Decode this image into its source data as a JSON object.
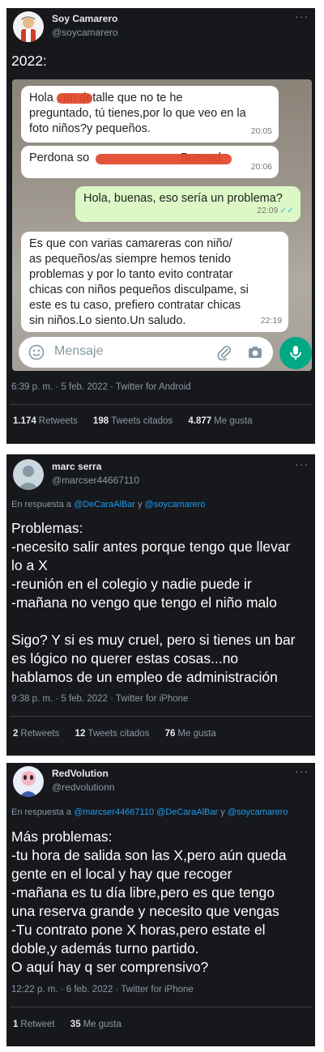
{
  "tweet1": {
    "name": "Soy Camarero",
    "handle": "@soycamarero",
    "more": "···",
    "text": "2022:",
    "chat": {
      "messages": [
        {
          "text": "Hola       , un detalle que no te he\npreguntado, tú tienes,por lo que veo en la\nfoto niños?y pequeños.",
          "time": "20:05"
        },
        {
          "text": "Perdona so                            Buenad",
          "time": "20:06"
        },
        {
          "text": "Hola, buenas, eso sería un problema?",
          "time": "22:09"
        },
        {
          "text": "Es que con varias camareras con niño/\nas pequeños/as siempre hemos tenido\nproblemas y por lo tanto evito contratar\nchicas con niños pequeños disculpame, si\neste es tu caso, prefiero contratar chicas\nsin niños.Lo siento.Un saludo.",
          "time": "22:19"
        }
      ],
      "input_placeholder": "Mensaje",
      "icons": [
        "emoji-icon",
        "attach-icon",
        "camera-icon",
        "mic-icon"
      ]
    },
    "meta": "6:39 p. m. · 5 feb. 2022 · Twitter for Android",
    "stats": [
      {
        "count": "1.174",
        "label": "Retweets"
      },
      {
        "count": "198",
        "label": "Tweets citados"
      },
      {
        "count": "4.877",
        "label": "Me gusta"
      }
    ]
  },
  "tweet2": {
    "name": "marc serra",
    "handle": "@marcser44667110",
    "more": "···",
    "reply_prefix": "En respuesta a",
    "mention1": "@DeCaraAlBar",
    "reply_and": "y",
    "mention2": "@soycamarero",
    "text": "Problemas:\n-necesito salir antes porque tengo que llevar\nlo a X\n-reunión en el colegio y nadie puede ir\n-mañana no vengo que tengo el niño malo\n\nSigo? Y si es muy cruel, pero si tienes un bar\nes lógico no querer estas cosas...no\nhablamos de un empleo de administración",
    "meta": "9:38 p. m. · 5 feb. 2022 · Twitter for iPhone",
    "stats": [
      {
        "count": "2",
        "label": "Retweets"
      },
      {
        "count": "12",
        "label": "Tweets citados"
      },
      {
        "count": "76",
        "label": "Me gusta"
      }
    ]
  },
  "tweet3": {
    "name": "RedVolution",
    "handle": "@redvolutionn",
    "more": "···",
    "reply_prefix": "En respuesta a",
    "mention1": "@marcser44667110",
    "mention2": "@DeCaraAlBar",
    "reply_and": "y",
    "mention3": "@soycamarero",
    "text": "Más problemas:\n-tu hora de salida son las X,pero aún queda\ngente en el local y hay que recoger\n-mañana es tu día libre,pero es que tengo\nuna reserva grande y necesito que vengas\n-Tu contrato pone X horas,pero estate el\ndoble,y además turno partido.\nO aquí hay q ser comprensivo?",
    "meta": "12:22 p. m. · 6 feb. 2022 · Twitter for iPhone",
    "stats": [
      {
        "count": "1",
        "label": "Retweet"
      },
      {
        "count": "35",
        "label": "Me gusta"
      }
    ]
  },
  "colors": {
    "card_bg": "#16181c",
    "link": "#1d9bf0",
    "secondary": "#8b98a5",
    "wa_green": "#00a884",
    "wa_out": "#dcf8c6"
  }
}
